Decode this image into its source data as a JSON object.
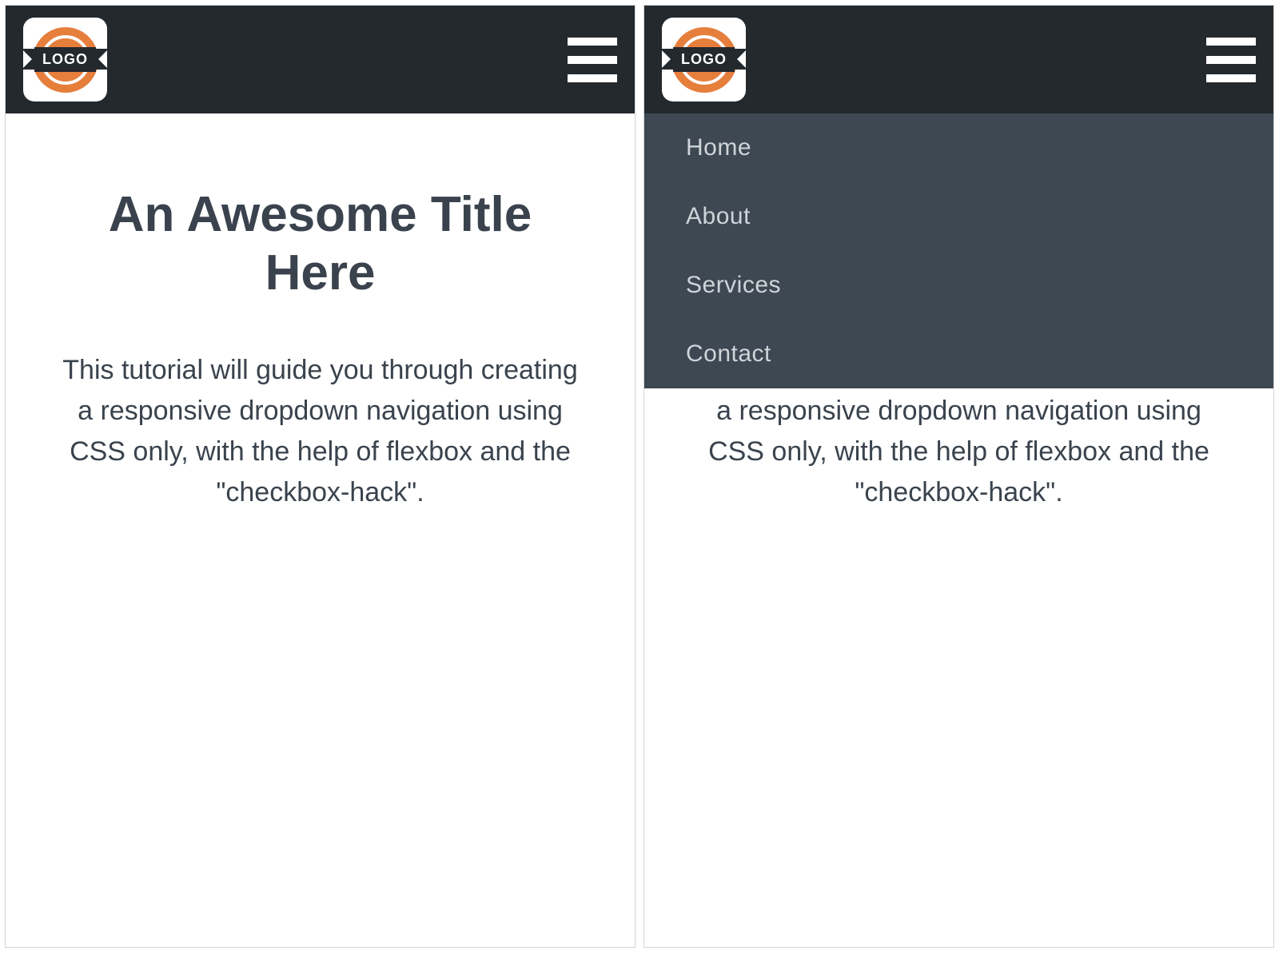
{
  "logo": {
    "text": "LOGO"
  },
  "nav": {
    "items": [
      {
        "label": "Home"
      },
      {
        "label": "About"
      },
      {
        "label": "Services"
      },
      {
        "label": "Contact"
      }
    ]
  },
  "page": {
    "title": "An Awesome Title Here",
    "description": "This tutorial will guide you through creating a responsive dropdown navigation using CSS only, with the help of flexbox and the \"checkbox-hack\"."
  }
}
